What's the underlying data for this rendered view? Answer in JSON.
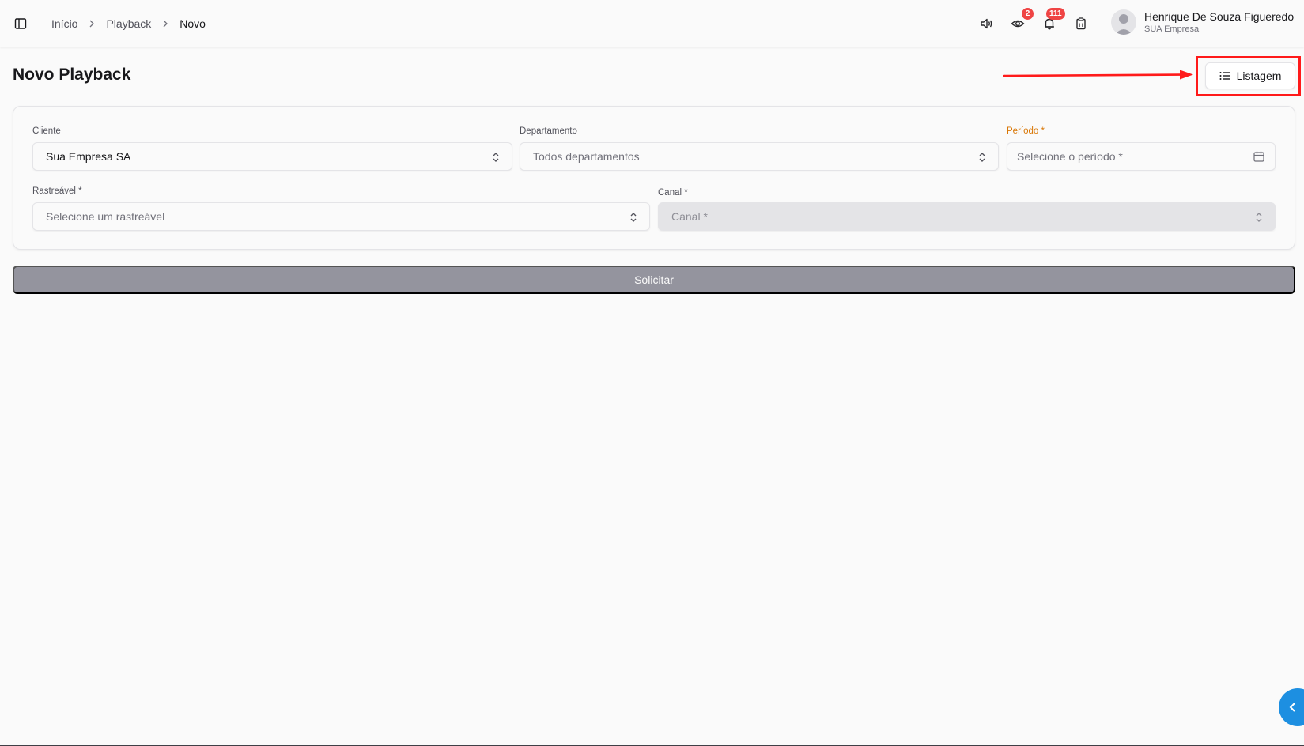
{
  "breadcrumb": {
    "items": [
      "Início",
      "Playback",
      "Novo"
    ]
  },
  "header": {
    "badges": {
      "eye": "2",
      "bell": "111"
    },
    "user": {
      "name": "Henrique De Souza Figueredo",
      "company": "SUA Empresa"
    }
  },
  "page": {
    "title": "Novo Playback",
    "list_button": "Listagem"
  },
  "form": {
    "cliente": {
      "label": "Cliente",
      "value": "Sua Empresa SA"
    },
    "departamento": {
      "label": "Departamento",
      "value": "Todos departamentos"
    },
    "periodo": {
      "label": "Período *",
      "placeholder": "Selecione o período *"
    },
    "rastreavel": {
      "label": "Rastreável *",
      "placeholder": "Selecione um rastreável"
    },
    "canal": {
      "label": "Canal *",
      "placeholder": "Canal *"
    },
    "submit": "Solicitar"
  },
  "colors": {
    "annotation": "#ff1a1a",
    "badge": "#ef4444",
    "required_label": "#d97706",
    "fab": "#1d8fe1",
    "submit_disabled": "#94949e"
  },
  "icons": [
    "sidebar-toggle-icon",
    "chevron-right-icon",
    "speaker-icon",
    "eye-icon",
    "bell-icon",
    "clipboard-icon",
    "list-icon",
    "chevron-up-down-icon",
    "calendar-icon",
    "chevron-left-icon"
  ]
}
